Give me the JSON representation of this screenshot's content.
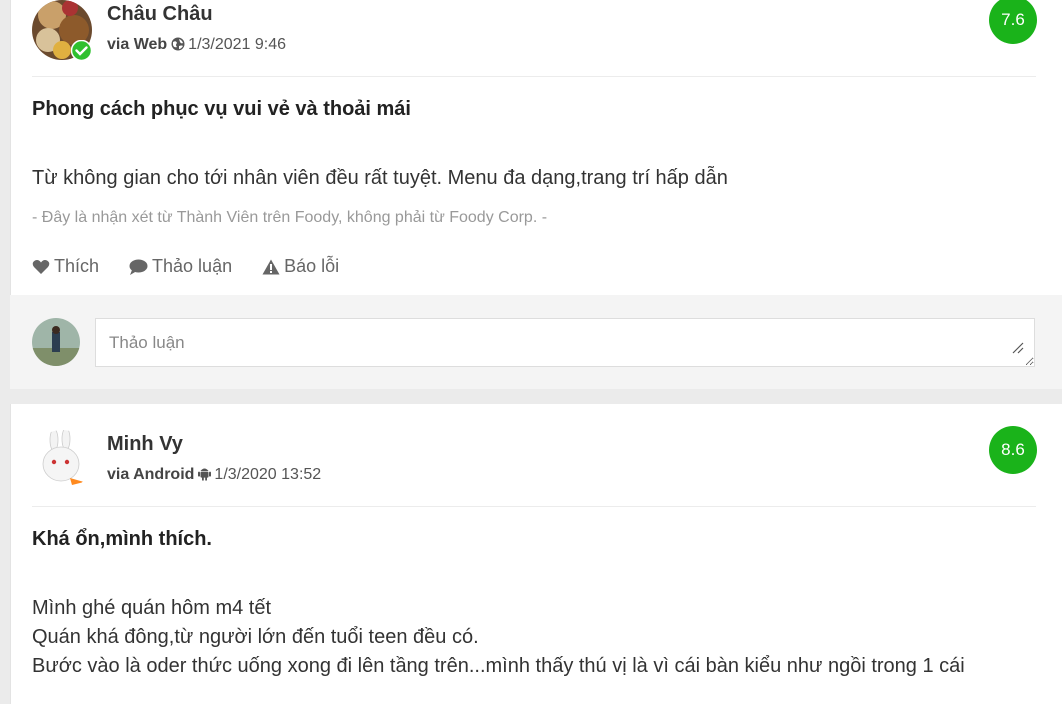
{
  "reviews": [
    {
      "user_name": "Châu Châu",
      "via": "via Web",
      "platform_icon": "globe-icon",
      "datetime": "1/3/2021 9:46",
      "score": "7.6",
      "title": "Phong cách phục vụ vui vẻ và thoải mái",
      "body_lines": [
        "Từ không gian cho tới nhân viên đều rất tuyệt. Menu đa dạng,trang trí hấp dẫn"
      ],
      "disclaimer": "- Đây là nhận xét từ Thành Viên trên Foody, không phải từ Foody Corp. -",
      "actions": {
        "like": "Thích",
        "discuss": "Thảo luận",
        "report": "Báo lỗi"
      },
      "comment_placeholder": "Thảo luận"
    },
    {
      "user_name": "Minh Vy",
      "via": "via Android",
      "platform_icon": "android-icon",
      "datetime": "1/3/2020 13:52",
      "score": "8.6",
      "title": "Khá ổn,mình thích.",
      "body_lines": [
        "Mình ghé quán hôm m4 tết",
        "Quán khá đông,từ người lớn đến tuổi teen đều có.",
        "Bước vào là oder thức uống xong đi lên tầng trên...mình thấy thú vị là vì cái bàn kiểu như ngồi trong 1 cái"
      ]
    }
  ],
  "colors": {
    "score_bg": "#1ab31a",
    "verified": "#2ec02e",
    "page_bg": "#ebebeb"
  }
}
